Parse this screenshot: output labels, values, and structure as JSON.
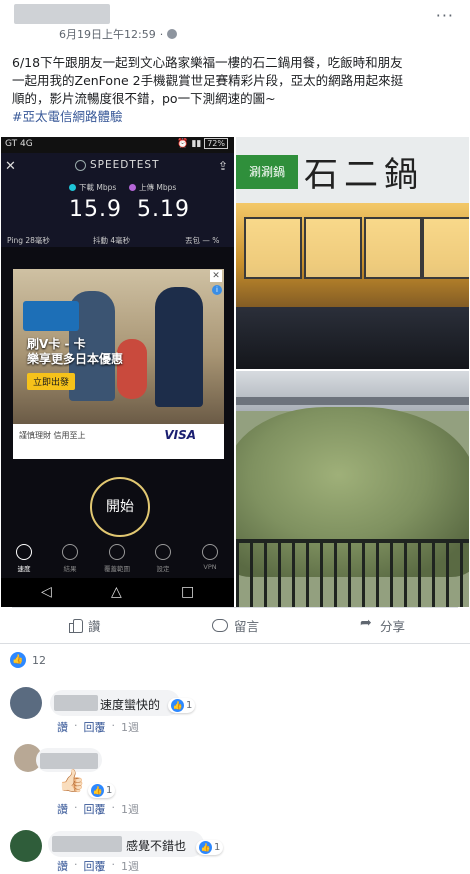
{
  "post": {
    "timestamp": "6月19日上午12:59",
    "more": "···",
    "text_lines": [
      "6/18下午跟朋友一起到文心路家樂福一樓的石二鍋用餐，吃飯時和朋友",
      "一起用我的ZenFone 2手機觀賞世足賽精彩片段，亞太的網路用起來挺",
      "順的，影片流暢度很不錯，po一下測網速的圖~"
    ],
    "hashtag": "#亞太電信網路體驗"
  },
  "speedtest": {
    "carrier": "GT 4G",
    "battery": "72%",
    "close": "✕",
    "share": "⇪",
    "title": "SPEEDTEST",
    "download_label": "下載 Mbps",
    "upload_label": "上傳 Mbps",
    "download_value": "15.9",
    "upload_value": "5.19",
    "ping": "Ping 28毫秒",
    "jitter": "抖動 4毫秒",
    "loss": "丟包 — %",
    "ad_headline": "刷V卡 ‑ 卡\n樂享更多日本優惠",
    "ad_button": "立即出發",
    "ad_note": "謹慎理財 信用至上",
    "ad_brand": "VISA",
    "ad_close": "✕",
    "ad_info": "i",
    "start_button": "開始",
    "nav": [
      "速度",
      "結果",
      "覆蓋範圍",
      "設定",
      "VPN"
    ],
    "sysnav": [
      "◁",
      "△",
      "□"
    ]
  },
  "restaurant": {
    "sign_green": "涮涮鍋",
    "sign_main": "石二鍋"
  },
  "actions": {
    "like": "讚",
    "comment": "留言",
    "share": "分享"
  },
  "reactions": {
    "count": "12",
    "badge": "👍"
  },
  "comments": [
    {
      "text": "速度蠻快的",
      "likes": "1",
      "like": "讚",
      "reply": "回覆",
      "time": "1週"
    },
    {
      "text": "",
      "sticker": "👍🏻",
      "likes": "1",
      "like": "讚",
      "reply": "回覆",
      "time": "1週"
    },
    {
      "text": "感覺不錯也",
      "likes": "1",
      "like": "讚",
      "reply": "回覆",
      "time": "1週"
    }
  ],
  "colors": {
    "link": "#385898",
    "like_blue": "#2d88ff",
    "muted": "#606770"
  }
}
